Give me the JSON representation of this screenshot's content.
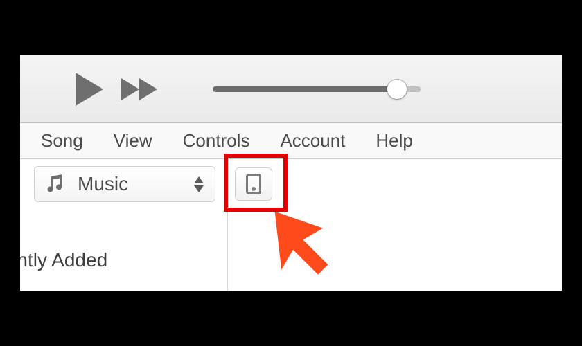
{
  "menu": {
    "items": [
      "Song",
      "View",
      "Controls",
      "Account",
      "Help"
    ]
  },
  "toolbar": {
    "library_label": "Music",
    "library_icon": "music-note-icon",
    "device_icon": "device-icon"
  },
  "playback": {
    "play_icon": "play-icon",
    "forward_icon": "fast-forward-icon",
    "volume_percent": 84
  },
  "sidebar": {
    "items": [
      {
        "label": "Recently Added"
      }
    ]
  },
  "annotation": {
    "highlight_color": "#e40000",
    "arrow_color": "#ff4a1c"
  }
}
